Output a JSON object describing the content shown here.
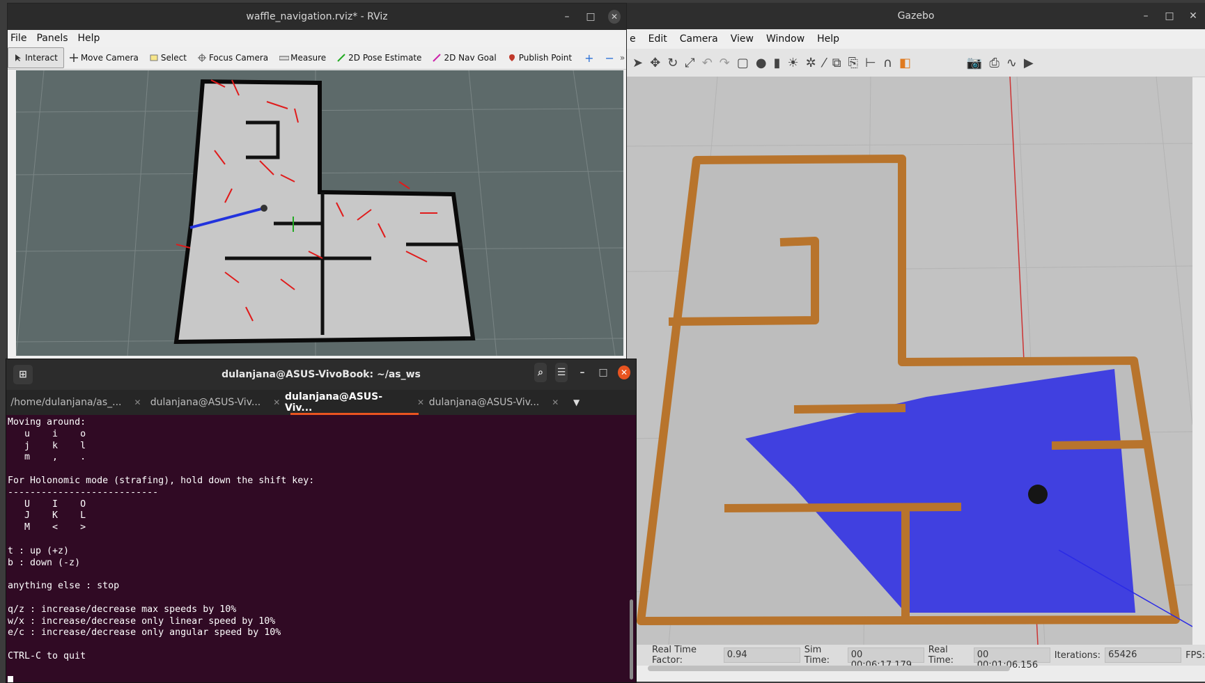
{
  "rviz": {
    "title": "waffle_navigation.rviz* - RViz",
    "menu": [
      "File",
      "Panels",
      "Help"
    ],
    "tools": [
      "Interact",
      "Move Camera",
      "Select",
      "Focus Camera",
      "Measure",
      "2D Pose Estimate",
      "2D Nav Goal",
      "Publish Point"
    ]
  },
  "gazebo": {
    "title": "Gazebo",
    "menu": [
      "e",
      "Edit",
      "Camera",
      "View",
      "Window",
      "Help"
    ],
    "status": {
      "rtf_label": "Real Time Factor:",
      "rtf_value": "0.94",
      "sim_label": "Sim Time:",
      "sim_value": "00 00:06:17.179",
      "real_label": "Real Time:",
      "real_value": "00 00:01:06.156",
      "iter_label": "Iterations:",
      "iter_value": "65426",
      "fps_label": "FPS:"
    }
  },
  "terminal": {
    "title": "dulanjana@ASUS-VivoBook: ~/as_ws",
    "tabs": [
      "/home/dulanjana/as_...",
      "dulanjana@ASUS-Viv...",
      "dulanjana@ASUS-Viv...",
      "dulanjana@ASUS-Viv..."
    ],
    "active_tab": 2,
    "lines": [
      "Moving around:",
      "   u    i    o",
      "   j    k    l",
      "   m    ,    .",
      "",
      "For Holonomic mode (strafing), hold down the shift key:",
      "---------------------------",
      "   U    I    O",
      "   J    K    L",
      "   M    <    >",
      "",
      "t : up (+z)",
      "b : down (-z)",
      "",
      "anything else : stop",
      "",
      "q/z : increase/decrease max speeds by 10%",
      "w/x : increase/decrease only linear speed by 10%",
      "e/c : increase/decrease only angular speed by 10%",
      "",
      "CTRL-C to quit",
      ""
    ]
  },
  "colors": {
    "terminal_bg": "#300a24",
    "accent_tab": "#e95420",
    "laser_blue": "#2020e0",
    "wall_wood": "#c8843a"
  }
}
